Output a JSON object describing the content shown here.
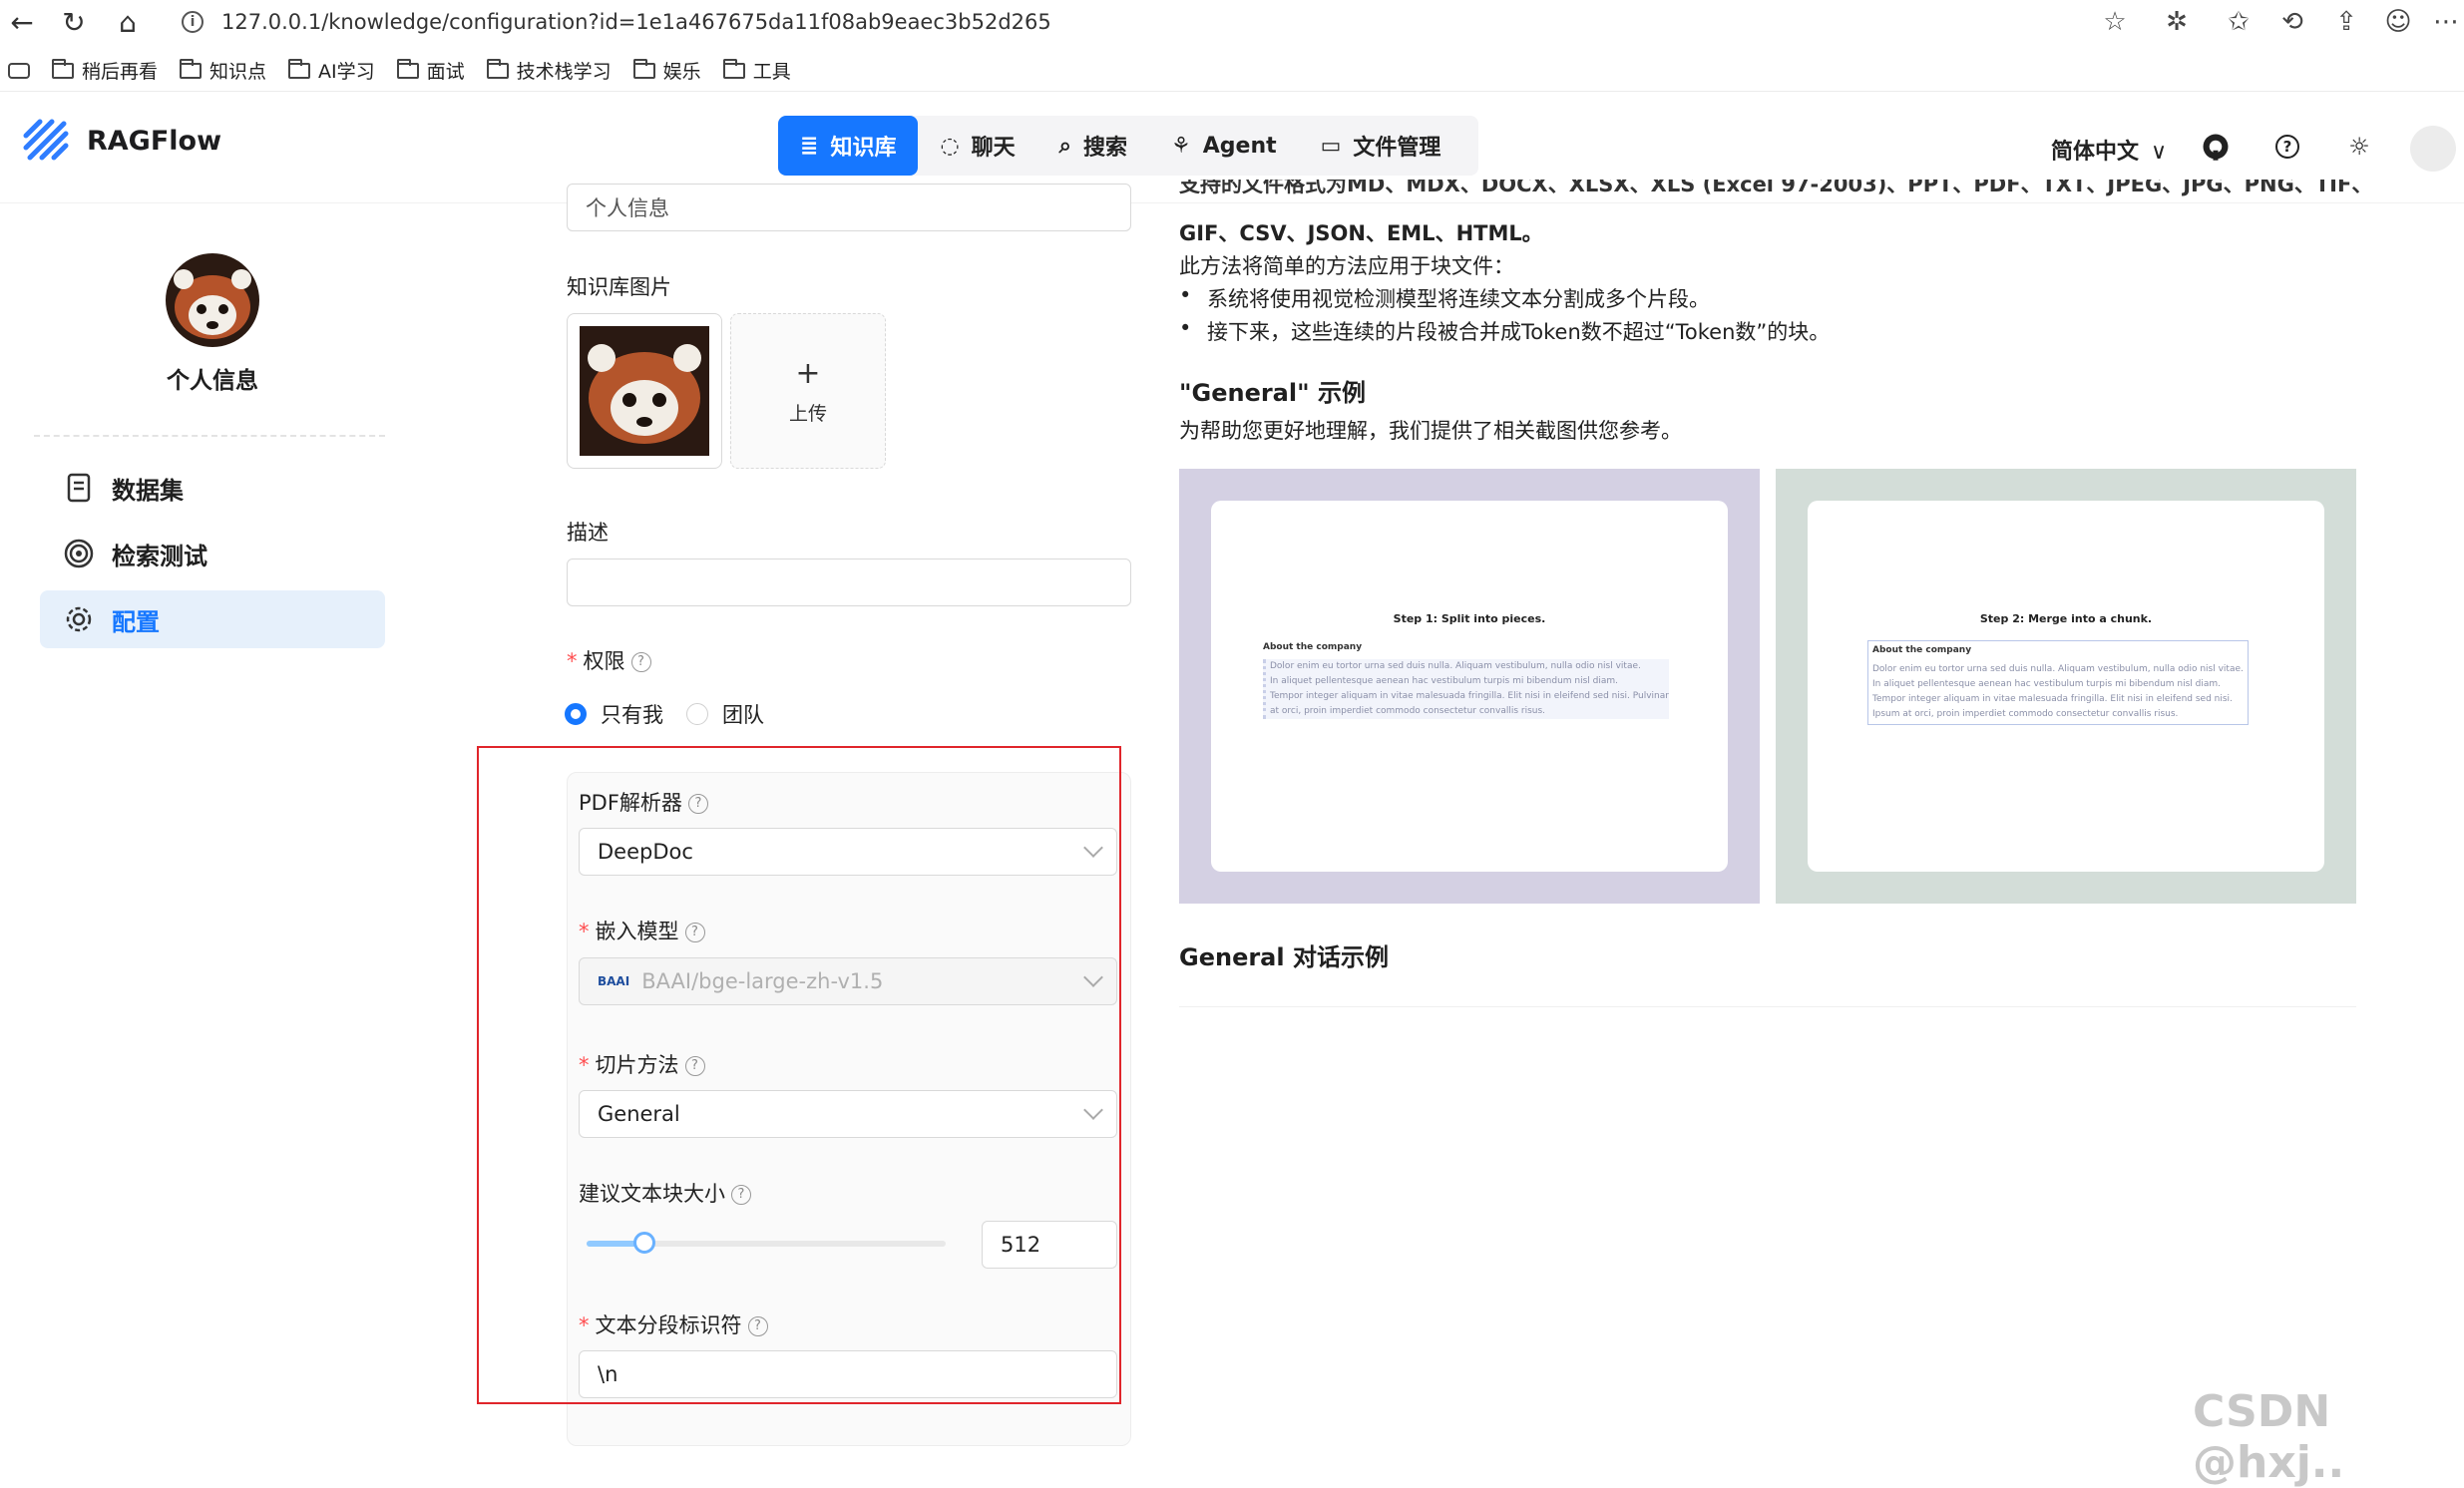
{
  "browser": {
    "url": "127.0.0.1/knowledge/configuration?id=1e1a467675da11f08ab9eaec3b52d265",
    "bookmarks": [
      "稍后再看",
      "知识点",
      "AI学习",
      "面试",
      "技术栈学习",
      "娱乐",
      "工具"
    ]
  },
  "header": {
    "brand": "RAGFlow",
    "nav": [
      {
        "label": "知识库",
        "icon": "database-icon",
        "active": true
      },
      {
        "label": "聊天",
        "icon": "chat-icon",
        "active": false
      },
      {
        "label": "搜索",
        "icon": "search-icon",
        "active": false
      },
      {
        "label": "Agent",
        "icon": "agent-icon",
        "active": false
      },
      {
        "label": "文件管理",
        "icon": "folder-icon",
        "active": false
      }
    ],
    "language": "简体中文"
  },
  "sidebar": {
    "profile_name": "个人信息",
    "items": [
      {
        "label": "数据集",
        "icon": "document-icon",
        "active": false
      },
      {
        "label": "检索测试",
        "icon": "target-icon",
        "active": false
      },
      {
        "label": "配置",
        "icon": "gear-icon",
        "active": true
      }
    ]
  },
  "form": {
    "name_value": "个人信息",
    "image_label": "知识库图片",
    "upload_label": "上传",
    "description_label": "描述",
    "description_value": "",
    "permission_label": "权限",
    "permission_options": [
      "只有我",
      "团队"
    ],
    "permission_selected": "只有我",
    "pdf_parser_label": "PDF解析器",
    "pdf_parser_value": "DeepDoc",
    "embedding_label": "嵌入模型",
    "embedding_value": "BAAI/bge-large-zh-v1.5",
    "embedding_logo_text": "BAAI",
    "chunk_method_label": "切片方法",
    "chunk_method_value": "General",
    "chunk_size_label": "建议文本块大小",
    "chunk_size_value": "512",
    "chunk_size_fraction": 0.16,
    "delimiter_label": "文本分段标识符",
    "delimiter_value": "\\n"
  },
  "right": {
    "top_partial": "支持的文件格式为MD、MDX、DOCX、XLSX、XLS (Excel 97-2003)、PPT、PDF、TXT、JPEG、JPG、PNG、TIF、",
    "formats_line": "GIF、CSV、JSON、EML、HTML。",
    "method_intro": "此方法将简单的方法应用于块文件：",
    "bullets": [
      "系统将使用视觉检测模型将连续文本分割成多个片段。",
      "接下来，这些连续的片段被合并成Token数不超过“Token数”的块。"
    ],
    "example_title": "\"General\" 示例",
    "example_desc": "为帮助您更好地理解，我们提供了相关截图供您参考。",
    "example_images": [
      {
        "step": "Step 1: Split into pieces.",
        "heading": "About the company",
        "lines": [
          "Dolor enim eu tortor urna sed duis nulla. Aliquam vestibulum, nulla odio nisl vitae.",
          "In aliquet pellentesque aenean hac vestibulum turpis mi bibendum nisl diam.",
          "Tempor integer aliquam in vitae malesuada fringilla. Elit nisi in eleifend sed nisi. Pulvinar",
          "at orci, proin imperdiet commodo consectetur convallis risus."
        ],
        "bg": "#d4d0e3"
      },
      {
        "step": "Step 2: Merge into a chunk.",
        "heading": "About the company",
        "lines": [
          "Dolor enim eu tortor urna sed duis nulla. Aliquam vestibulum, nulla odio nisl vitae.",
          "In aliquet pellentesque aenean hac vestibulum turpis mi bibendum nisl diam.",
          "Tempor integer aliquam in vitae malesuada fringilla. Elit nisi in eleifend sed nisi.",
          "Ipsum at orci, proin imperdiet commodo consectetur convallis risus."
        ],
        "bg": "#d3ddd8"
      }
    ],
    "dialog_title": "General 对话示例"
  },
  "watermark": "CSDN @hxj.."
}
